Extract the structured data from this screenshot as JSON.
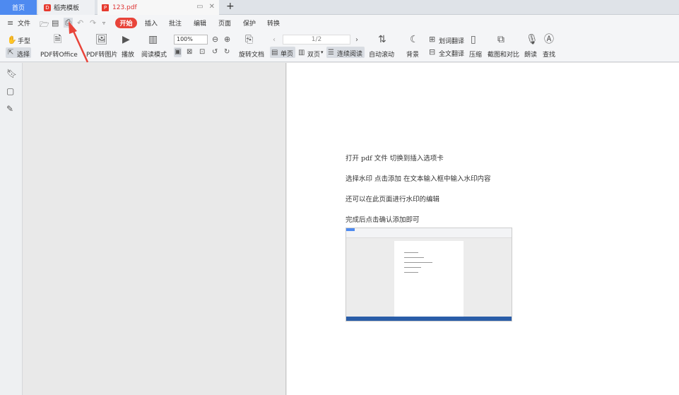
{
  "tabs": {
    "home": "首页",
    "template": "稻壳模板",
    "template_badge": "D",
    "pdf": "123.pdf",
    "pdf_badge": "P",
    "new_tab": "+"
  },
  "menu": {
    "file": "文件",
    "start": "开始",
    "items": [
      "插入",
      "批注",
      "编辑",
      "页面",
      "保护",
      "转换"
    ]
  },
  "ribbon": {
    "hand": "手型",
    "select": "选择",
    "pdf_to_office": "PDF转Office",
    "pdf_to_image": "PDF转图片",
    "play": "播放",
    "read_mode": "阅读模式",
    "zoom": "100%",
    "rotate": "旋转文档",
    "single": "单页",
    "double": "双页",
    "continuous": "连续阅读",
    "page_indicator": "1/2",
    "auto_scroll": "自动滚动",
    "background": "背景",
    "word_translate": "划词翻译",
    "full_translate": "全文翻译",
    "compress": "压缩",
    "screenshot": "截图和对比",
    "read_aloud": "朗读",
    "find": "查找"
  },
  "document": {
    "lines": [
      "打开 pdf 文件    切换到插入选项卡",
      "选择水印      点击添加    在文本输入框中输入水印内容",
      "还可以在此页面进行水印的编辑",
      "完成后点击确认添加即可"
    ]
  },
  "colors": {
    "accent": "#4e8af0",
    "start_button": "#e8443a",
    "arrow": "#e8443a"
  }
}
